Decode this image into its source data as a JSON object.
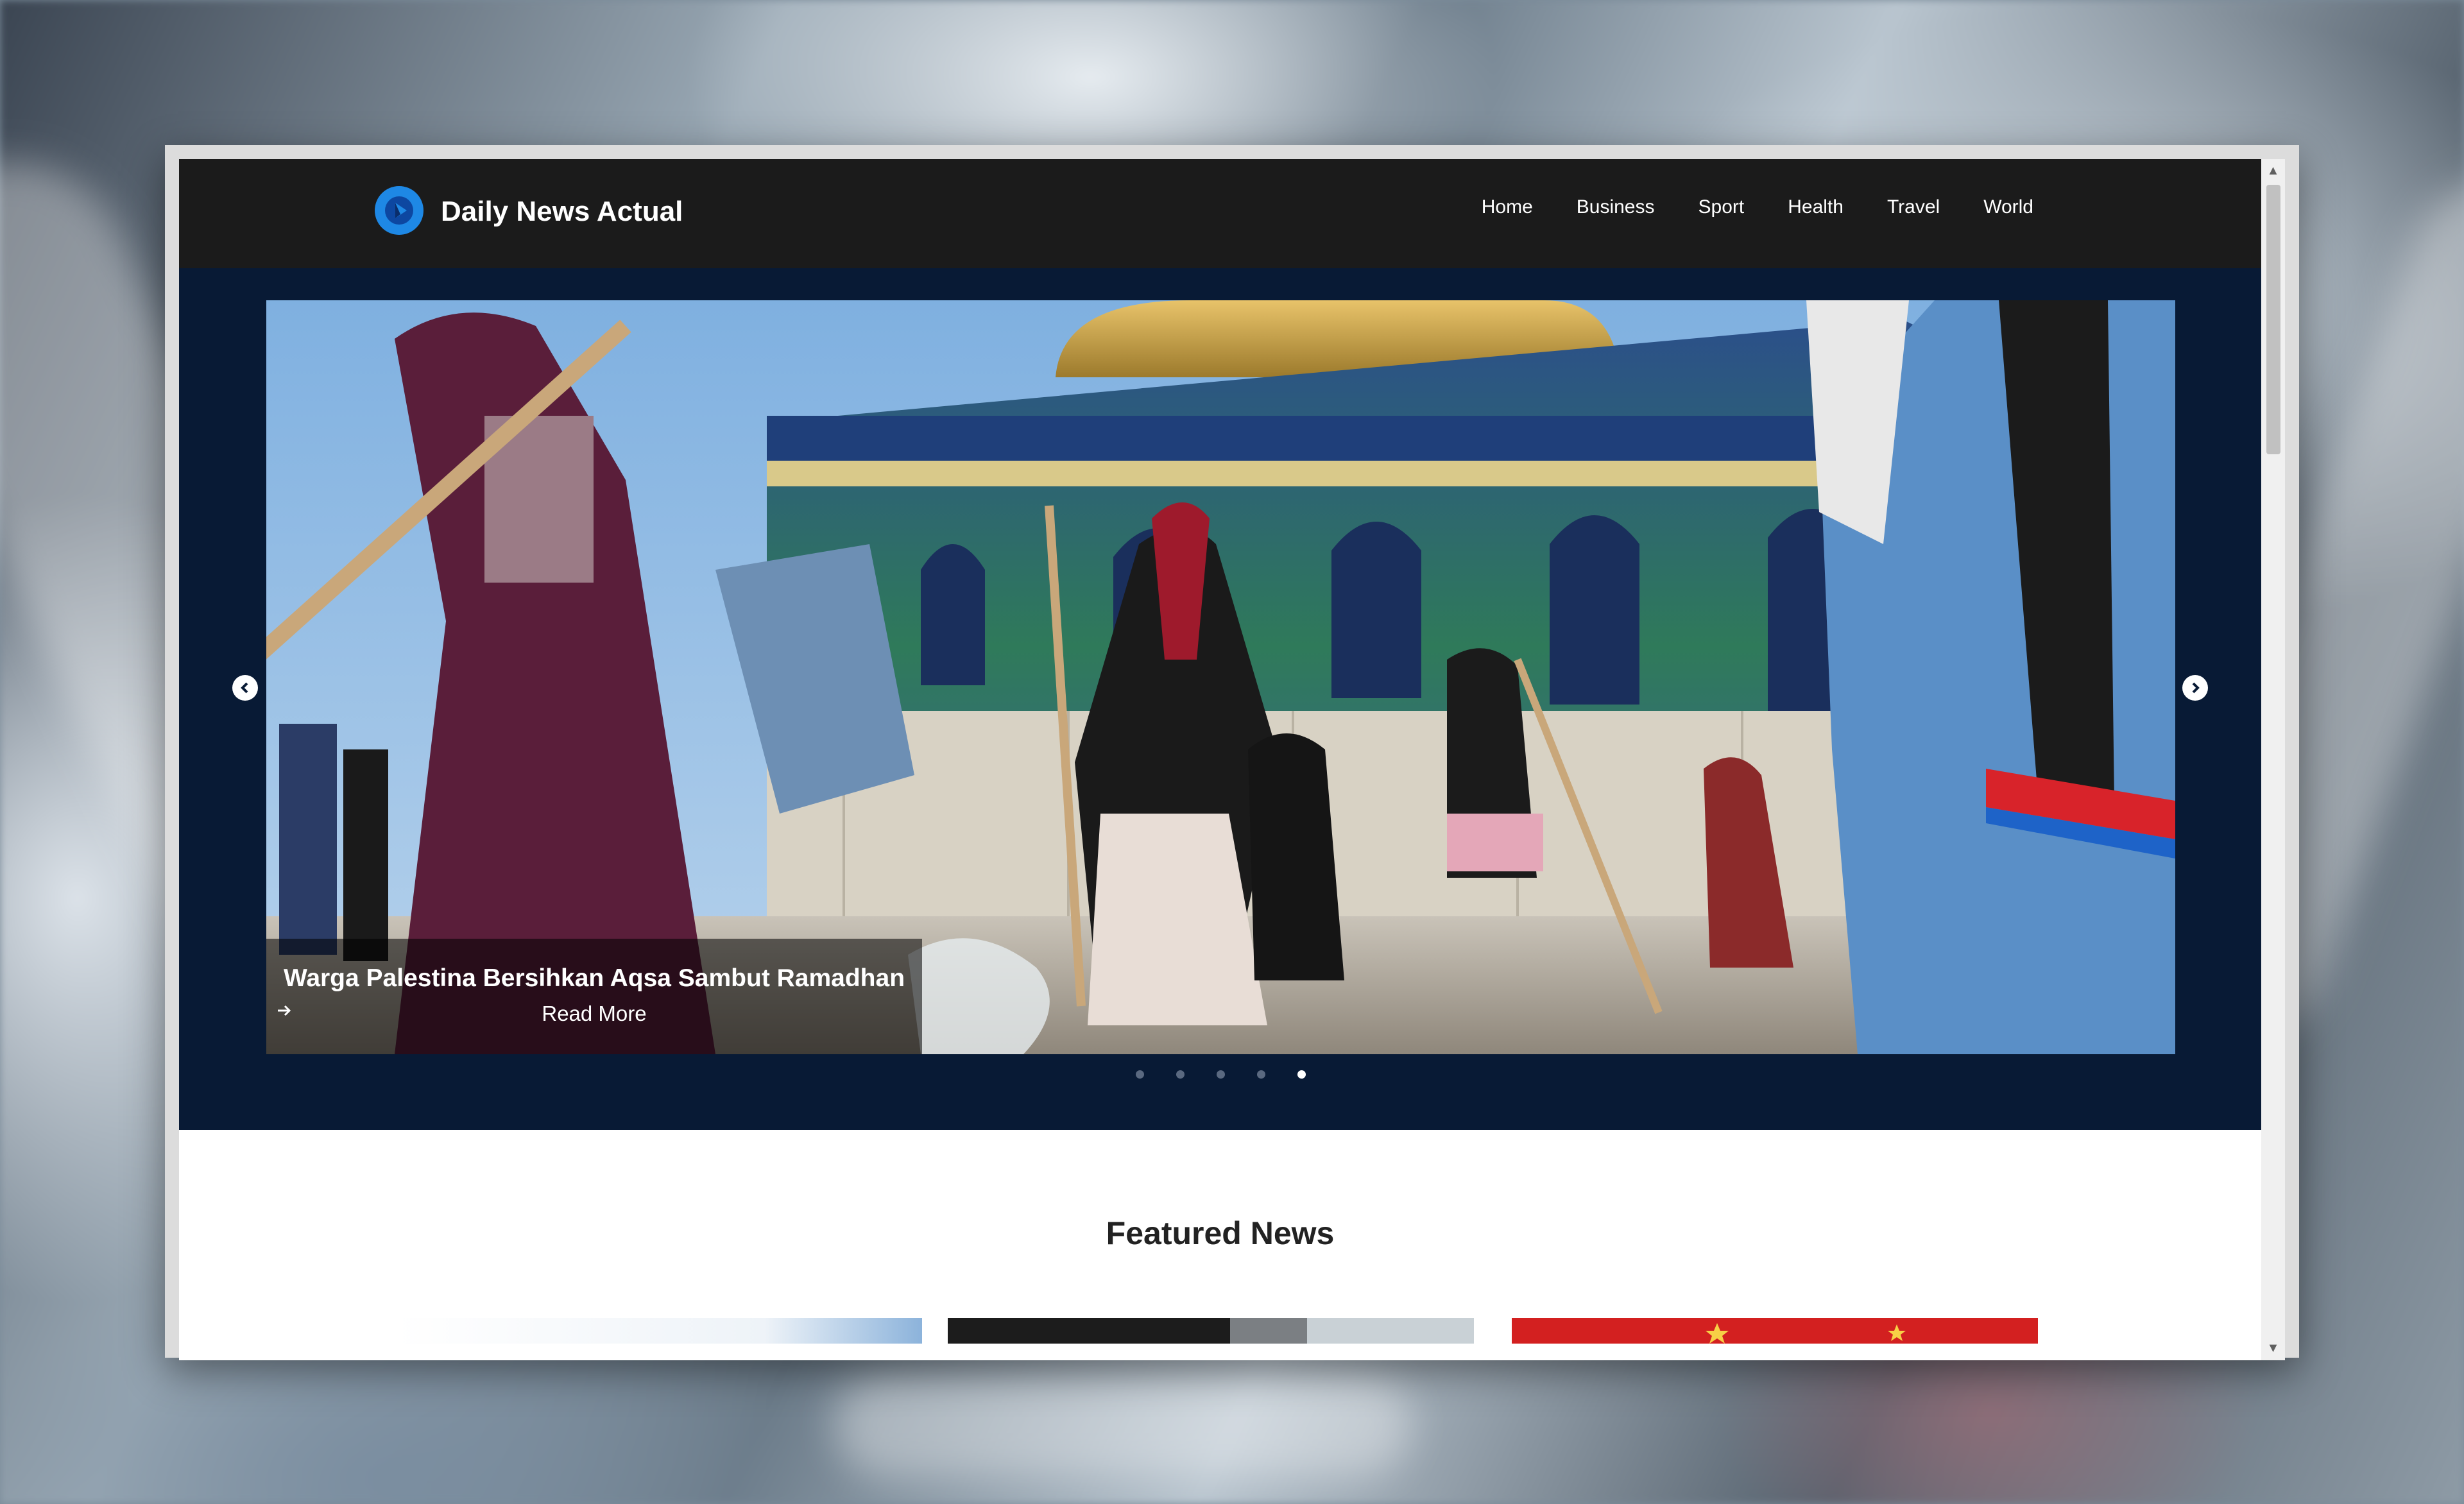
{
  "header": {
    "site_title": "Daily News Actual",
    "nav": [
      "Home",
      "Business",
      "Sport",
      "Health",
      "Travel",
      "World"
    ]
  },
  "hero": {
    "caption_title": "Warga Palestina Bersihkan Aqsa Sambut Ramadhan",
    "read_more": "Read More",
    "slide_count": 5,
    "active_slide": 5
  },
  "featured": {
    "title": "Featured News"
  },
  "colors": {
    "header_bg": "#1b1b1b",
    "hero_bg": "#081a35",
    "logo_accent": "#1e88e5"
  },
  "icons": [
    "logo-icon",
    "chevron-left-icon",
    "chevron-right-icon",
    "arrow-right-icon",
    "scroll-up-icon",
    "scroll-down-icon"
  ]
}
